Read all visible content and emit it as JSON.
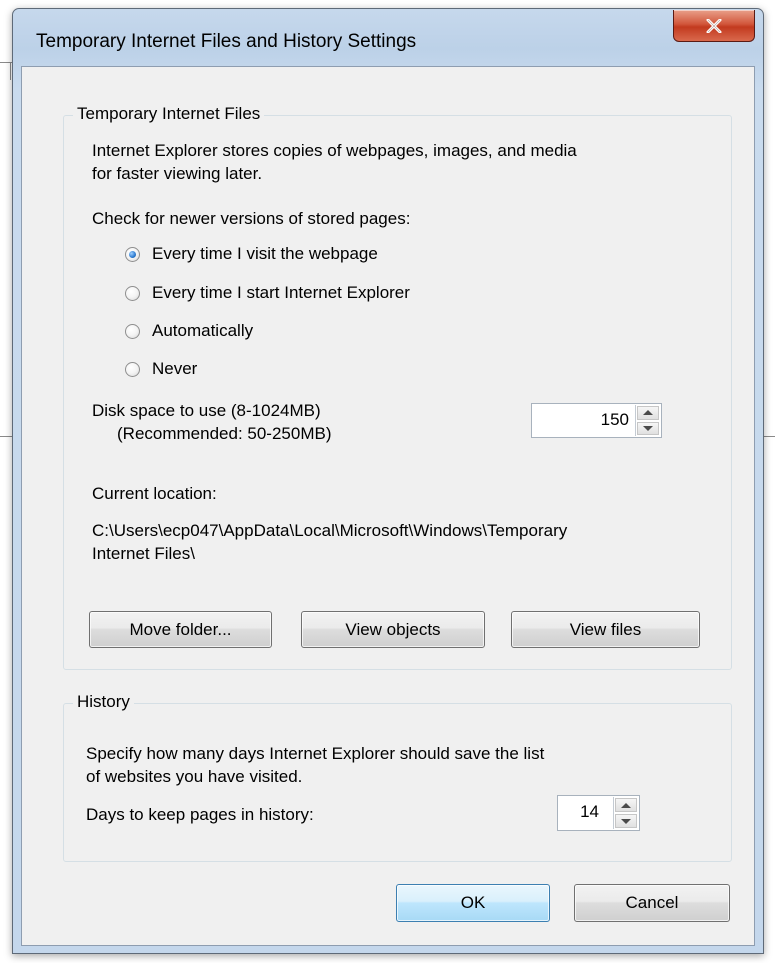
{
  "window": {
    "title": "Temporary Internet Files and History Settings",
    "close_glyph": "X"
  },
  "temp_files": {
    "legend": "Temporary Internet Files",
    "description_line1": "Internet Explorer stores copies of webpages, images, and media",
    "description_line2": "for faster viewing later.",
    "check_label": "Check for newer versions of stored pages:",
    "options": [
      {
        "label": "Every time I visit the webpage",
        "checked": true
      },
      {
        "label": "Every time I start Internet Explorer",
        "checked": false
      },
      {
        "label": "Automatically",
        "checked": false
      },
      {
        "label": "Never",
        "checked": false
      }
    ],
    "disk_label_line1": "Disk space to use (8-1024MB)",
    "disk_label_line2": "(Recommended: 50-250MB)",
    "disk_value": "150",
    "current_location_label": "Current location:",
    "path_line1": "C:\\Users\\ecp047\\AppData\\Local\\Microsoft\\Windows\\Temporary",
    "path_line2": "Internet Files\\",
    "buttons": {
      "move_folder": "Move folder...",
      "view_objects": "View objects",
      "view_files": "View files"
    }
  },
  "history": {
    "legend": "History",
    "description_line1": "Specify how many days Internet Explorer should save the list",
    "description_line2": "of websites you have visited.",
    "days_label": "Days to keep pages in history:",
    "days_value": "14"
  },
  "footer": {
    "ok": "OK",
    "cancel": "Cancel"
  },
  "colors": {
    "frame": "#c4d7ec",
    "close_button": "#c9452a",
    "client": "#f0f0f0",
    "default_button": "#bee6fd"
  }
}
